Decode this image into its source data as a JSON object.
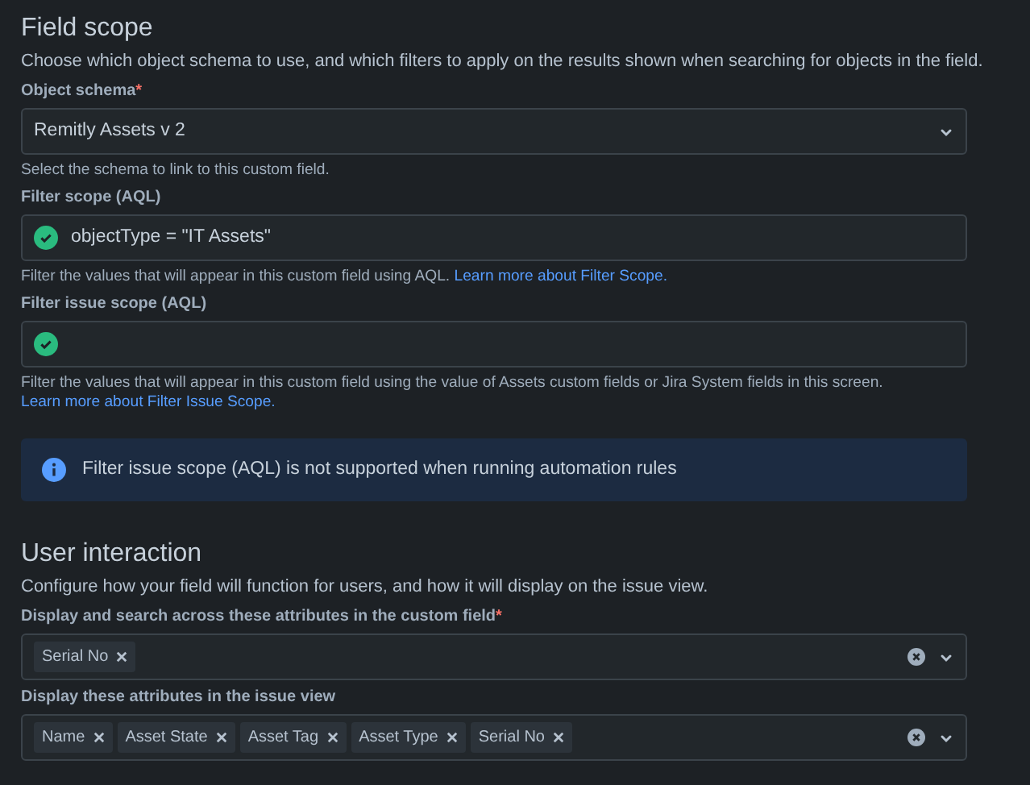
{
  "sections": [
    {
      "title": "Field scope",
      "description": "Choose which object schema to use, and which filters to apply on the results shown when searching for objects in the field.",
      "items": [
        {
          "kind": "select",
          "label": "Object schema",
          "required_mark": "*",
          "value": "Remitly Assets v 2",
          "help": "Select the schema to link to this custom field."
        },
        {
          "kind": "aql",
          "label": "Filter scope (AQL)",
          "valid": true,
          "value": "objectType = \"IT Assets\"",
          "help": "Filter the values that will appear in this custom field using AQL.",
          "help_link": "Learn more about Filter Scope."
        },
        {
          "kind": "aql",
          "label": "Filter issue scope (AQL)",
          "valid": true,
          "help": "Filter the values that will appear in this custom field using the value of Assets custom fields or Jira System fields in this screen.",
          "help_link": "Learn more about Filter Issue Scope."
        },
        {
          "kind": "info",
          "text": "Filter issue scope (AQL) is not supported when running automation rules"
        }
      ]
    },
    {
      "title": "User interaction",
      "description": "Configure how your field will function for users, and how it will display on the issue view.",
      "items": [
        {
          "kind": "multi",
          "label": "Display and search across these attributes in the custom field",
          "required_mark": "*",
          "tags": [
            "Serial No"
          ]
        },
        {
          "kind": "multi",
          "label": "Display these attributes in the issue view",
          "tags": [
            "Name",
            "Asset State",
            "Asset Tag",
            "Asset Type",
            "Serial No"
          ]
        }
      ]
    }
  ]
}
